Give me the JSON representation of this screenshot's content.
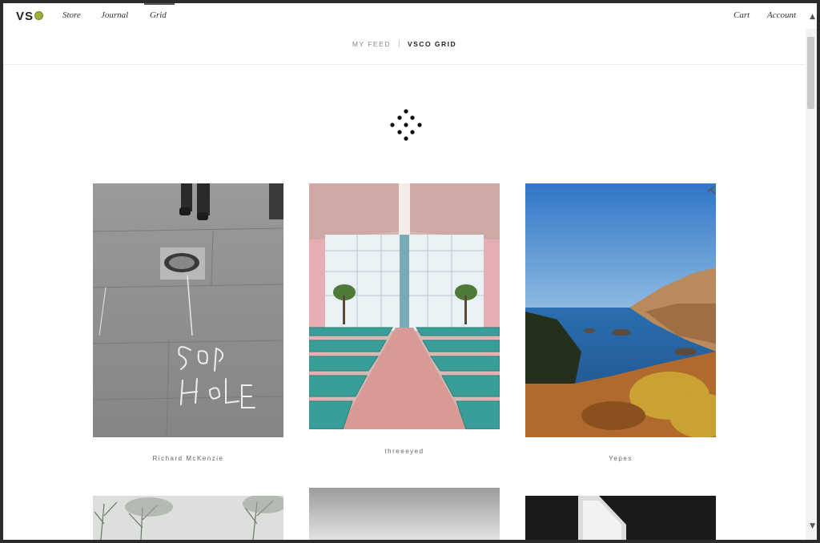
{
  "nav": {
    "logo_text": "VS",
    "links": [
      "Store",
      "Journal",
      "Grid"
    ],
    "right_links": [
      "Cart",
      "Account"
    ]
  },
  "feed_tabs": {
    "my_feed": "MY FEED",
    "vsco_grid": "VSCO GRID",
    "active": "vsco_grid"
  },
  "photos": [
    {
      "caption": "Richard McKenzie",
      "subject": "pavement with chalk writing"
    },
    {
      "caption": "threeeyed",
      "subject": "chapel interior with teal pews"
    },
    {
      "caption": "Yepes",
      "subject": "coastal cliffs over blue sea"
    },
    {
      "caption": "",
      "subject": "foggy trees"
    },
    {
      "caption": "",
      "subject": "grey gradient sky"
    },
    {
      "caption": "",
      "subject": "dark architectural detail"
    }
  ],
  "colors": {
    "logo_accent": "#9bb33a",
    "pew_teal": "#3a9e98",
    "sea_blue": "#2a6fb0"
  }
}
